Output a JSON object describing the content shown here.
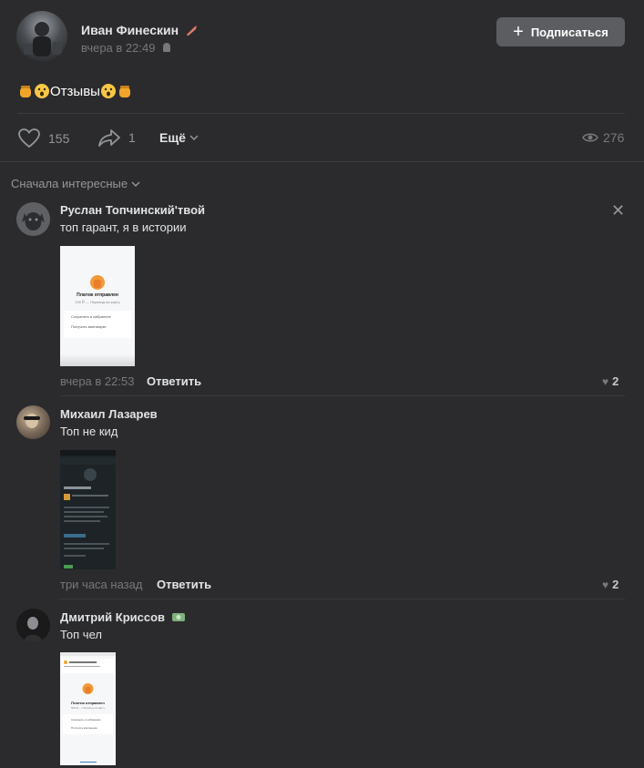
{
  "post": {
    "author": "Иван Финескин",
    "time": "вчера в 22:49",
    "subscribe_label": "Подписаться",
    "text": "Отзывы",
    "likes": "155",
    "shares": "1",
    "more_label": "Ещё",
    "views": "276"
  },
  "comments_sort": "Сначала интересные",
  "comments": [
    {
      "author": "Руслан Топчинский'твой",
      "text": "топ гарант, я в истории",
      "time": "вчера в 22:53",
      "reply_label": "Ответить",
      "likes": "2",
      "attachment": {
        "title": "Платеж отправлен",
        "subtitle": "150 ₽ — Перевод на карту",
        "item1": "Сохранить в избранное",
        "item2": "Получить квитанцию"
      }
    },
    {
      "author": "Михаил Лазарев",
      "text": "Топ не кид",
      "time": "три часа назад",
      "reply_label": "Ответить",
      "likes": "2"
    },
    {
      "author": "Дмитрий Криссов",
      "text": "Топ чел",
      "attachment": {
        "title": "Платеж отправлен",
        "subtitle": "500 ₽ — Перевод на карту",
        "item1": "Сохранить в избранное",
        "item2": "Получить квитанцию"
      }
    }
  ],
  "colors": {
    "background": "#2b2b2d",
    "divider": "#3a3b3d",
    "button": "#5c5d60",
    "muted": "#76787a"
  }
}
